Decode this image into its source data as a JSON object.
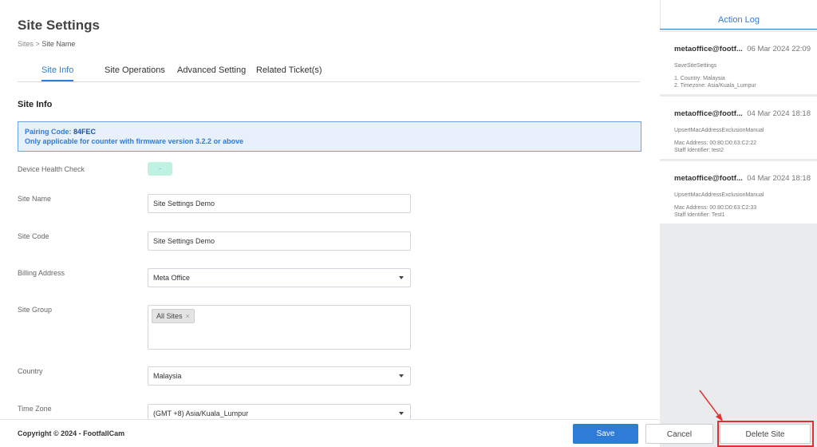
{
  "page": {
    "title": "Site Settings",
    "breadcrumb_root": "Sites",
    "breadcrumb_sep": ">",
    "breadcrumb_current": "Site Name"
  },
  "tabs": [
    "Site Info",
    "Site Operations",
    "Advanced Setting",
    "Related Ticket(s)"
  ],
  "section": {
    "title": "Site Info"
  },
  "pairing": {
    "label": "Pairing Code:",
    "code": "84FEC",
    "note": "Only applicable for counter with firmware version 3.2.2 or above"
  },
  "fields": {
    "device_health": {
      "label": "Device Health Check",
      "value": "-"
    },
    "site_name": {
      "label": "Site Name",
      "value": "Site Settings Demo"
    },
    "site_code": {
      "label": "Site Code",
      "value": "Site Settings Demo"
    },
    "billing_address": {
      "label": "Billing Address",
      "value": "Meta Office"
    },
    "site_group": {
      "label": "Site Group",
      "chip": "All Sites",
      "remove": "×"
    },
    "country": {
      "label": "Country",
      "value": "Malaysia"
    },
    "time_zone": {
      "label": "Time Zone",
      "value": "(GMT +8) Asia/Kuala_Lumpur"
    }
  },
  "footer": {
    "copyright": "Copyright © 2024 - FootfallCam"
  },
  "buttons": {
    "save": "Save",
    "cancel": "Cancel",
    "delete": "Delete Site"
  },
  "action_log": {
    "title": "Action Log",
    "entries": [
      {
        "user": "metaoffice@footf...",
        "date": "06 Mar 2024 22:09",
        "action": "SaveSiteSettings",
        "line1": "1. Country: Malaysia",
        "line2": "2. Timezone: Asia/Kuala_Lumpur"
      },
      {
        "user": "metaoffice@footf...",
        "date": "04 Mar 2024 18:18",
        "action": "UpsertMacAddressExclusionManual",
        "line1": "Mac Address: 00:80:D0:63:C2:22",
        "line2": "Staff Identifier: test2"
      },
      {
        "user": "metaoffice@footf...",
        "date": "04 Mar 2024 18:18",
        "action": "UpsertMacAddressExclusionManual",
        "line1": "Mac Address: 00:80:D0:63:C2:33",
        "line2": "Staff Identifier: Test1"
      }
    ]
  },
  "colors": {
    "accent": "#2f7cd8",
    "highlight": "#e03030",
    "panel_bg": "#eaebec"
  },
  "icons": {
    "dropdown": "caret-down-icon",
    "chip_remove": "close-icon",
    "annotation": "arrow-icon"
  }
}
